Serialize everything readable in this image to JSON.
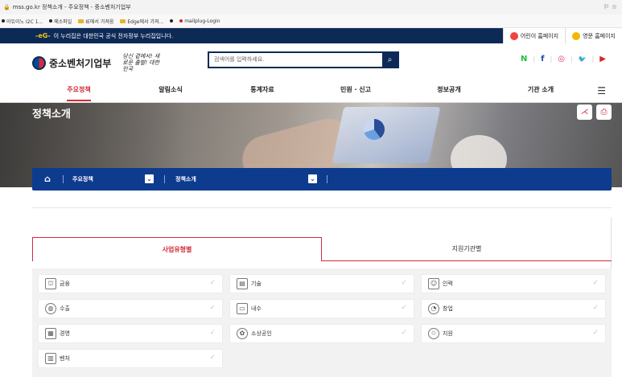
{
  "browser": {
    "title": "mss.go.kr 정책소개 - 주요정책 - 중소벤처기업부",
    "controls": "⚐ ☆",
    "favorites": [
      {
        "label": "아듀이노 I2C 1...",
        "icon": "dot"
      },
      {
        "label": "메소파일",
        "icon": "folder"
      },
      {
        "label": "IE에서 가져옴",
        "icon": "folder"
      },
      {
        "label": "Edge에서 가져...",
        "icon": "folder"
      },
      {
        "label": "",
        "icon": "dot"
      },
      {
        "label": "mailplug-Login",
        "icon": "red-dot"
      }
    ]
  },
  "gov_banner": {
    "mark": "-eG-",
    "text": "이 누리집은 대한민국 공식 전자정부 누리집입니다.",
    "links": [
      {
        "label": "어린이 홈페이지"
      },
      {
        "label": "영문 홈페이지"
      }
    ]
  },
  "header": {
    "logo_text": "중소벤처기업부",
    "slogan": "당신 곁에서! 새로운 출발! 대한민국",
    "search_placeholder": "검색어를 입력하세요.",
    "social": [
      "N",
      "f",
      "◎",
      "🐦",
      "▶"
    ]
  },
  "menu": {
    "items": [
      "주요정책",
      "알림소식",
      "통계자료",
      "민원 · 신고",
      "정보공개",
      "기관 소개"
    ],
    "active": "주요정책",
    "hamburger": "☰"
  },
  "hero": {
    "title": "정책소개",
    "share_icon": "⋌",
    "print_icon": "⎙"
  },
  "breadcrumb": {
    "home": "⌂",
    "level1": "주요정책",
    "level2": "정책소개"
  },
  "tabs": [
    "사업유형별",
    "지원기관별"
  ],
  "categories": [
    {
      "label": "금융",
      "icon": "⛫"
    },
    {
      "label": "기술",
      "icon": "▤"
    },
    {
      "label": "인력",
      "icon": "☺"
    },
    {
      "label": "수출",
      "icon": "◍"
    },
    {
      "label": "내수",
      "icon": "▭"
    },
    {
      "label": "창업",
      "icon": "◔"
    },
    {
      "label": "경영",
      "icon": "▦"
    },
    {
      "label": "소상공인",
      "icon": "✿"
    },
    {
      "label": "지원",
      "icon": "♲"
    },
    {
      "label": "벤처",
      "icon": "▥"
    }
  ],
  "check_mark": "✓"
}
